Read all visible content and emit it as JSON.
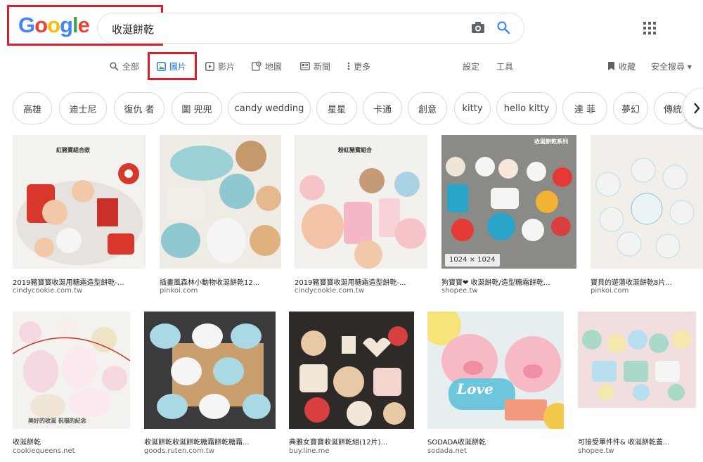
{
  "logo": {
    "letters": [
      "G",
      "o",
      "o",
      "g",
      "l",
      "e"
    ],
    "colors": [
      "#4285f4",
      "#ea4335",
      "#fbbc05",
      "#4285f4",
      "#34a853",
      "#ea4335"
    ]
  },
  "search": {
    "value": "收涎餅乾"
  },
  "icons": {
    "camera": "camera-icon",
    "search": "search-icon",
    "apps": "apps-grid-icon"
  },
  "nav": {
    "all": "全部",
    "images": "圖片",
    "videos": "影片",
    "maps": "地圖",
    "news": "新聞",
    "more": "更多",
    "settings": "設定",
    "tools": "工具",
    "saved": "收藏",
    "safesearch": "安全搜尋 ▾"
  },
  "accent": "#1a73e8",
  "highlight": "#d8202c",
  "chips": [
    "高雄",
    "迪士尼",
    "復仇 者",
    "圖 兜兜",
    "candy wedding",
    "星星",
    "卡通",
    "創意",
    "kitty",
    "hello kitty",
    "達 菲",
    "夢幻",
    "傳統"
  ],
  "results_row1": [
    {
      "caption": "2019豬寶寶收涎用糖霜造型餅乾-...",
      "source": "cindycookie.com.tw",
      "overlay": "紅豬寶組合款"
    },
    {
      "caption": "插畫風森林小動物收涎餅乾12...",
      "source": "pinkoi.com",
      "overlay": ""
    },
    {
      "caption": "2019豬寶寶收涎用糖霜造型餅乾-...",
      "source": "cindycookie.com.tw",
      "overlay": "粉紅豬寶組合"
    },
    {
      "caption": "狗寶寶❤ 收涎餅乾/造型糖霜餅乾...",
      "source": "shopee.tw",
      "overlay": "收涎餅乾系列",
      "dims": "1024 × 1024"
    },
    {
      "caption": "寶貝的遊蕩收涎餅乾8片...",
      "source": "pinkoi.com",
      "overlay": ""
    }
  ],
  "results_row2": [
    {
      "caption": "收涎餅乾",
      "source": "cookiequeens.net",
      "overlay": "美好的收涎  祝福的紀念"
    },
    {
      "caption": "收涎餅乾收涎餅乾糖霜餅乾糖霜...",
      "source": "goods.ruten.com.tw",
      "overlay": ""
    },
    {
      "caption": "典雅女寶寶收涎餅乾組(12片)...",
      "source": "buy.line.me",
      "overlay": ""
    },
    {
      "caption": "SODADA收涎餅乾",
      "source": "sodada.net",
      "overlay": "Love"
    },
    {
      "caption": "可接受單件件& 收涎餅乾蓋...",
      "source": "shopee.tw",
      "overlay": ""
    }
  ]
}
